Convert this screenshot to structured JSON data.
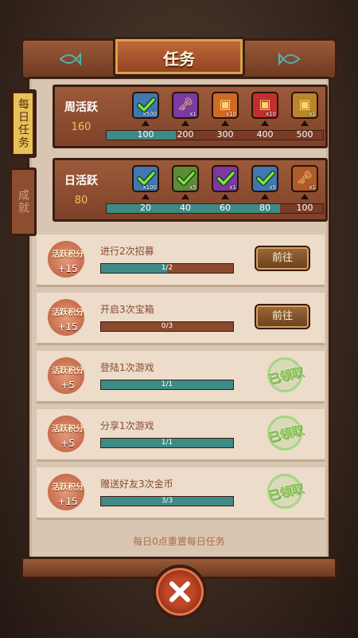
{
  "title": "任务",
  "side_tabs": {
    "daily": "每日任务",
    "achievement": "成就"
  },
  "weekly": {
    "title": "周活跃",
    "score": "160",
    "progress_fraction": 0.32,
    "milestones": [
      "100",
      "200",
      "300",
      "400",
      "500"
    ],
    "rewards": [
      {
        "icon": "claimed-check-icon",
        "qty": "x500",
        "color": "#3f78b3",
        "claimed": true
      },
      {
        "icon": "golden-key-icon",
        "qty": "x1",
        "color": "#7a3aa0",
        "claimed": false
      },
      {
        "icon": "treasure-chest-icon",
        "qty": "x10",
        "color": "#d06a28",
        "claimed": false
      },
      {
        "icon": "red-chest-icon",
        "qty": "x10",
        "color": "#c03030",
        "claimed": false
      },
      {
        "icon": "golden-chest-icon",
        "qty": "x1",
        "color": "#b8862c",
        "claimed": false
      }
    ]
  },
  "daily": {
    "title": "日活跃",
    "score": "80",
    "progress_fraction": 0.8,
    "milestones": [
      "20",
      "40",
      "60",
      "80",
      "100"
    ],
    "rewards": [
      {
        "icon": "claimed-check-icon",
        "qty": "x100",
        "color": "#3f78b3",
        "claimed": true
      },
      {
        "icon": "claimed-check-icon",
        "qty": "x5",
        "color": "#5f8a3a",
        "claimed": true
      },
      {
        "icon": "claimed-check-icon",
        "qty": "x1",
        "color": "#7a3aa0",
        "claimed": true
      },
      {
        "icon": "claimed-check-icon",
        "qty": "x5",
        "color": "#3f78b3",
        "claimed": true
      },
      {
        "icon": "golden-key-icon",
        "qty": "x1",
        "color": "#b05a2a",
        "claimed": false
      }
    ]
  },
  "tasks": [
    {
      "badge_label": "活跃积分",
      "points": "+15",
      "desc": "进行2次招募",
      "progress": "1/2",
      "fraction": 0.5,
      "status": "go",
      "action_label": "前往"
    },
    {
      "badge_label": "活跃积分",
      "points": "+15",
      "desc": "开启3次宝箱",
      "progress": "0/3",
      "fraction": 0.0,
      "status": "go",
      "action_label": "前往"
    },
    {
      "badge_label": "活跃积分",
      "points": "+5",
      "desc": "登陆1次游戏",
      "progress": "1/1",
      "fraction": 1.0,
      "status": "claimed",
      "action_label": "已领取"
    },
    {
      "badge_label": "活跃积分",
      "points": "+5",
      "desc": "分享1次游戏",
      "progress": "1/1",
      "fraction": 1.0,
      "status": "claimed",
      "action_label": "已领取"
    },
    {
      "badge_label": "活跃积分",
      "points": "+15",
      "desc": "赠送好友3次金币",
      "progress": "3/3",
      "fraction": 1.0,
      "status": "claimed",
      "action_label": "已领取"
    }
  ],
  "reset_note": "每日0点重置每日任务",
  "colors": {
    "accent_teal": "#3d8a86",
    "frame": "#3a1d10",
    "stamp_green": "#86c34e"
  }
}
